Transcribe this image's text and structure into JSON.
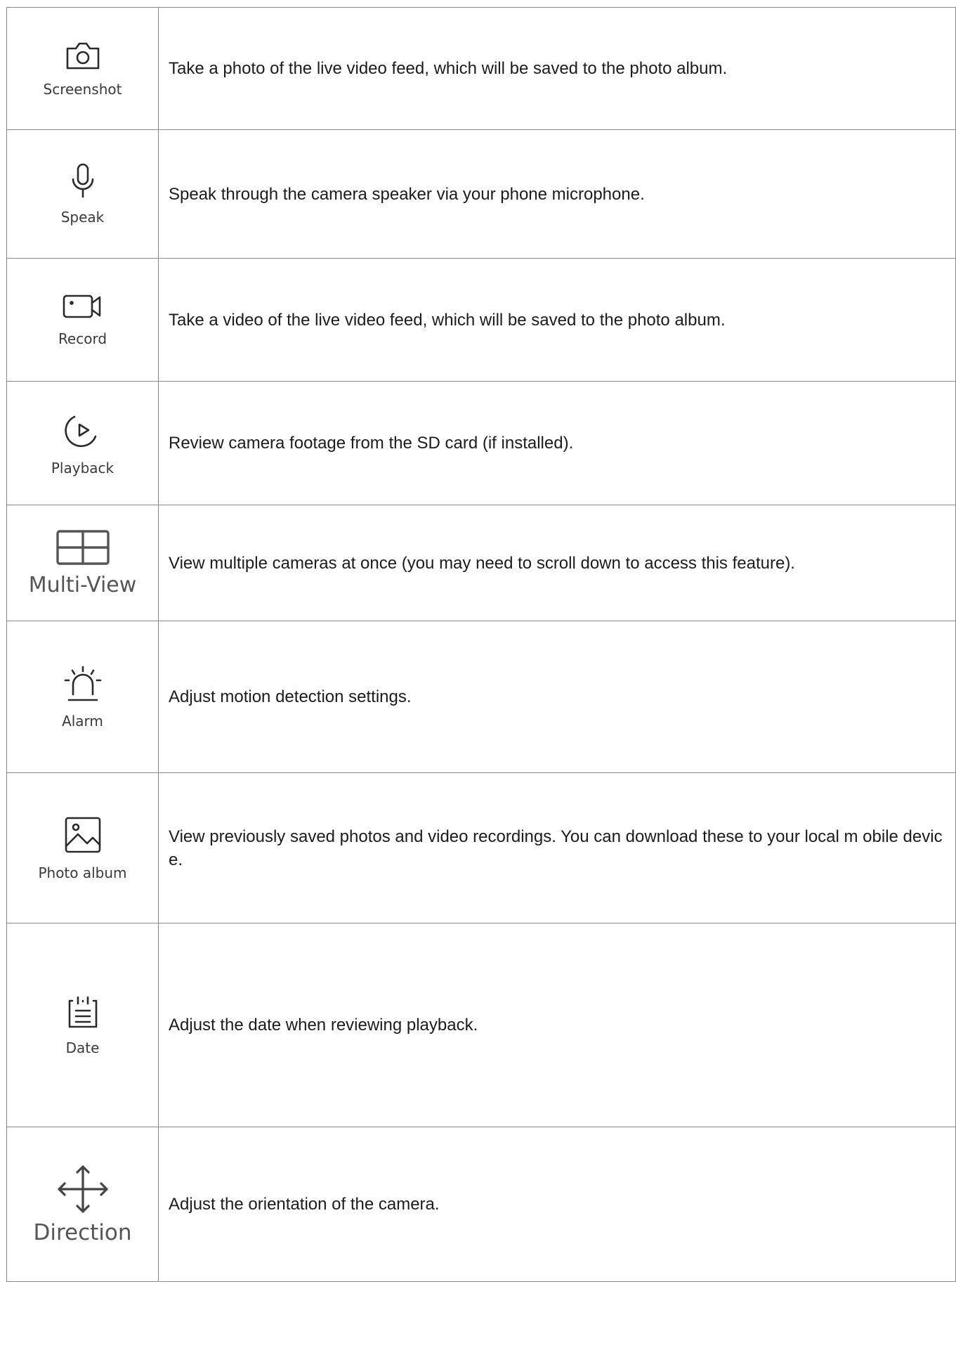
{
  "rows": [
    {
      "icon": "camera-icon",
      "label": "Screenshot",
      "description": "Take a photo of the live video feed, which will be saved to the photo album."
    },
    {
      "icon": "microphone-icon",
      "label": "Speak",
      "description": "Speak through the camera speaker via your phone microphone."
    },
    {
      "icon": "video-camera-icon",
      "label": "Record",
      "description": "Take a video of the live video feed, which will be saved to the photo album."
    },
    {
      "icon": "playback-icon",
      "label": "Playback",
      "description": "Review camera footage from the SD card (if installed)."
    },
    {
      "icon": "grid-icon",
      "label": "Multi-View",
      "description": "View multiple cameras at once (you may need to scroll down to access this feature)."
    },
    {
      "icon": "alarm-icon",
      "label": "Alarm",
      "description": "Adjust motion detection settings."
    },
    {
      "icon": "photo-album-icon",
      "label": "Photo album",
      "description": "View previously saved photos and video recordings. You can download these to your local m obile device."
    },
    {
      "icon": "calendar-icon",
      "label": "Date",
      "description": "Adjust the date when reviewing playback."
    },
    {
      "icon": "direction-arrows-icon",
      "label": "Direction",
      "description": "Adjust the orientation of the camera."
    }
  ]
}
